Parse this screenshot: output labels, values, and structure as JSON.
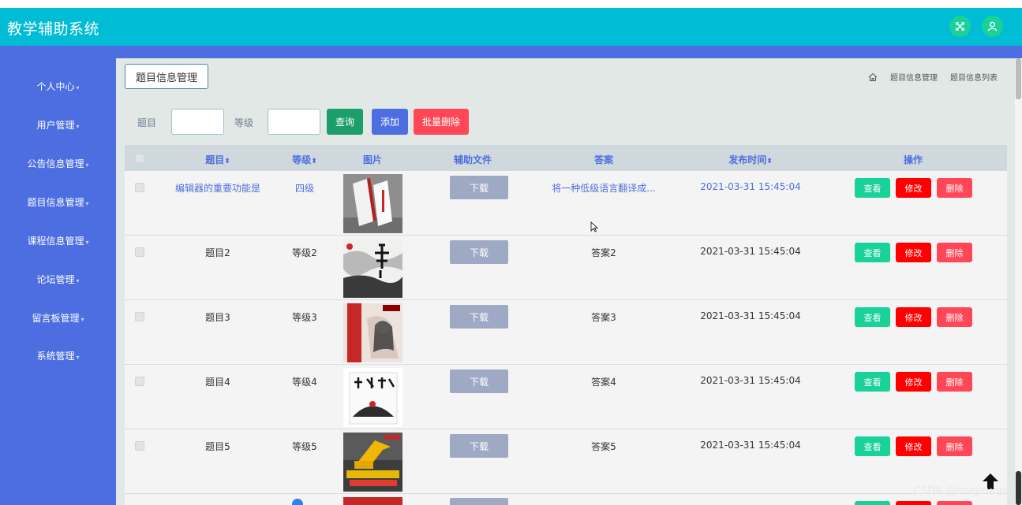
{
  "app": {
    "title": "教学辅助系统"
  },
  "sidebar": {
    "items": [
      {
        "label": "个人中心"
      },
      {
        "label": "用户管理"
      },
      {
        "label": "公告信息管理"
      },
      {
        "label": "题目信息管理"
      },
      {
        "label": "课程信息管理"
      },
      {
        "label": "论坛管理"
      },
      {
        "label": "留言板管理"
      },
      {
        "label": "系统管理"
      }
    ]
  },
  "page": {
    "tab_label": "题目信息管理"
  },
  "breadcrumb": {
    "level1": "题目信息管理",
    "level2": "题目信息列表"
  },
  "filters": {
    "title_label": "题目",
    "level_label": "等级",
    "query_button": "查询",
    "add_button": "添加",
    "batch_delete_button": "批量删除"
  },
  "table": {
    "headers": {
      "title": "题目",
      "level": "等级",
      "image": "图片",
      "file": "辅助文件",
      "answer": "答案",
      "time": "发布时间",
      "actions": "操作"
    },
    "sort_glyph": "⬍",
    "download_label": "下载",
    "view_label": "查看",
    "edit_label": "修改",
    "delete_label": "删除",
    "rows": [
      {
        "title": "编辑器的重要功能是",
        "level": "四级",
        "answer": "将一种低级语言翻译成...",
        "time": "2021-03-31 15:45:04"
      },
      {
        "title": "题目2",
        "level": "等级2",
        "answer": "答案2",
        "time": "2021-03-31 15:45:04"
      },
      {
        "title": "题目3",
        "level": "等级3",
        "answer": "答案3",
        "time": "2021-03-31 15:45:04"
      },
      {
        "title": "题目4",
        "level": "等级4",
        "answer": "答案4",
        "time": "2021-03-31 15:45:04"
      },
      {
        "title": "题目5",
        "level": "等级5",
        "answer": "答案5",
        "time": "2021-03-31 15:45:04"
      }
    ]
  },
  "watermark": "CSDN @shejizuopin",
  "colors": {
    "header": "#00bcd4",
    "sidebar": "#4d6ee0",
    "query": "#1b9e6a",
    "add": "#4d6ee0",
    "batch_delete": "#ff4757",
    "view": "#19d29a",
    "edit": "#ff0000",
    "delete": "#ff4757"
  }
}
